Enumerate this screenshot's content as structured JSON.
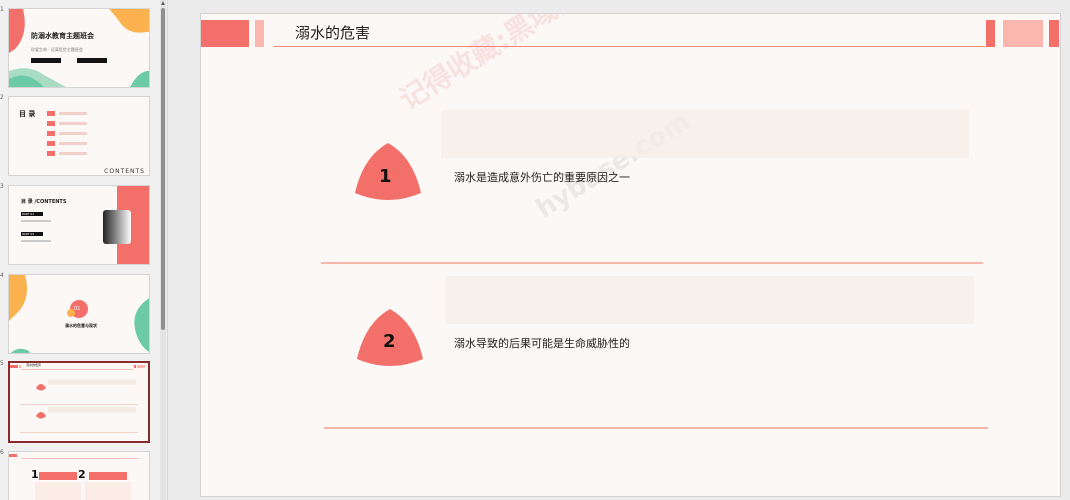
{
  "colors": {
    "accent": "#f26f6a",
    "accent_light": "#fbb6ae",
    "mint": "#6ccaa6",
    "orange": "#fbb14d"
  },
  "thumbnails": [
    {
      "num": "1",
      "title": "防溺水教育主题班会",
      "subtitle": "珍爱生命 · 远离危险主题班会"
    },
    {
      "num": "2",
      "title": "目 录",
      "footer": "CONTENTS"
    },
    {
      "num": "3",
      "title": "目 录 /CONTENTS",
      "part1": "PART 01",
      "part2": "PART 02"
    },
    {
      "num": "4",
      "badge": "01",
      "caption": "溺水的危害与现状"
    },
    {
      "num": "5",
      "title": "溺水的危害"
    },
    {
      "num": "6",
      "n1": "1",
      "n2": "2"
    }
  ],
  "slide": {
    "title": "溺水的危害",
    "items": [
      {
        "number": "1",
        "text": "溺水是造成意外伤亡的重要原因之一"
      },
      {
        "number": "2",
        "text": "溺水导致的后果可能是生命威胁性的"
      }
    ]
  },
  "watermark": {
    "text": "记得收藏:黑域基地",
    "site": "hybase.com"
  }
}
